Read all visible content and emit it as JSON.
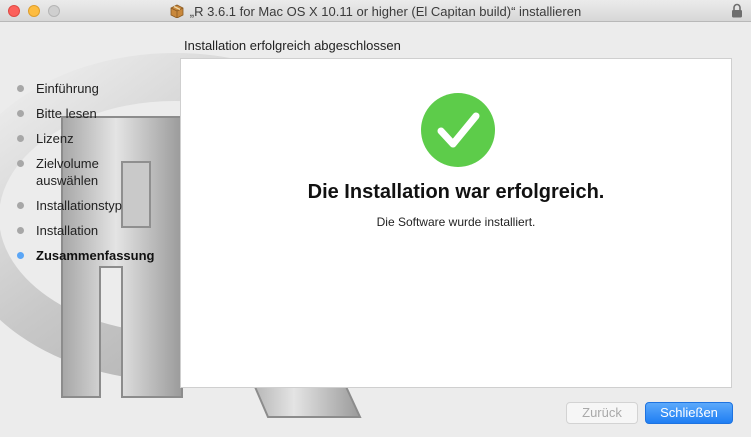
{
  "window": {
    "title": "„R 3.6.1 for Mac OS X 10.11 or higher (El Capitan build)“ installieren"
  },
  "sidebar": {
    "steps": [
      {
        "label": "Einführung"
      },
      {
        "label": "Bitte lesen"
      },
      {
        "label": "Lizenz"
      },
      {
        "label": "Zielvolume auswählen"
      },
      {
        "label": "Installationstyp"
      },
      {
        "label": "Installation"
      },
      {
        "label": "Zusammenfassung",
        "active": true
      }
    ]
  },
  "main": {
    "section_title": "Installation erfolgreich abgeschlossen",
    "headline": "Die Installation war erfolgreich.",
    "subline": "Die Software wurde installiert."
  },
  "buttons": {
    "back_label": "Zurück",
    "close_label": "Schließen"
  },
  "colors": {
    "success": "#5dcc4a",
    "accent": "#2a88f5"
  },
  "icons": {
    "package": "package-icon",
    "lock": "lock-icon",
    "success": "checkmark-icon"
  }
}
